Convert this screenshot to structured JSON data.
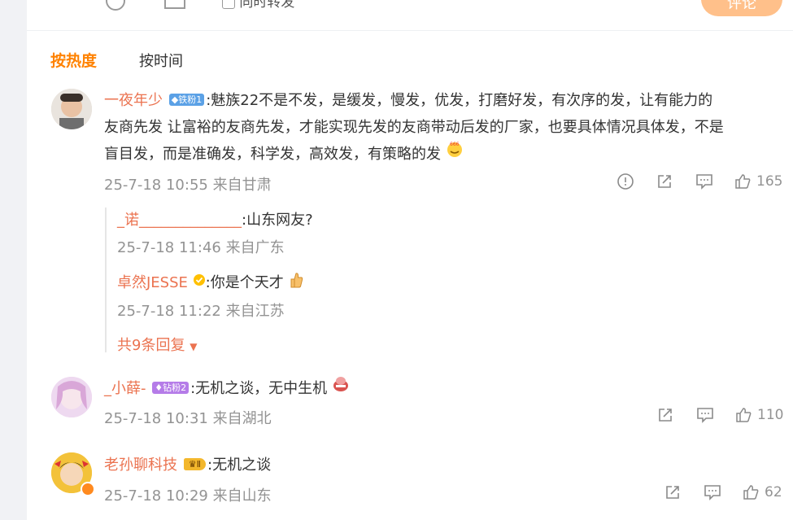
{
  "topbar": {
    "partial_label": "同时转发",
    "submit_label": "评论"
  },
  "sort": {
    "hot_label": "按热度",
    "time_label": "按时间"
  },
  "comments": [
    {
      "author": "一夜年少",
      "badge": "铁粉1",
      "text_line1": ":魅族22不是不发，是缓发，慢发，优发，打磨好发，有次序的发，让有能力的",
      "text_line2": "友商先发 让富裕的友商先发，才能实现先发的友商带动后发的厂家，也要具体情况具体发，不是",
      "text_line3": "盲目发，而是准确发，科学发，高效发，有策略的发",
      "time": "25-7-18 10:55 来自甘肃",
      "likes": "165",
      "replies": [
        {
          "author": "_诺______________",
          "text": ":山东网友?",
          "time": "25-7-18 11:46 来自广东"
        },
        {
          "author": "卓然JESSE",
          "text": ":你是个天才",
          "time": "25-7-18 11:22 来自江苏"
        }
      ],
      "more_replies": "共9条回复"
    },
    {
      "author": "_小薛-",
      "badge": "钻粉2",
      "text": ":无机之谈，无中生机",
      "time": "25-7-18 10:31 来自湖北",
      "likes": "110"
    },
    {
      "author": "老孙聊科技",
      "badge": "Ⅱ",
      "text": ":无机之谈",
      "time": "25-7-18 10:29 来自山东",
      "likes": "62"
    }
  ],
  "colors": {
    "accent": "#ff8200",
    "username": "#eb7350",
    "meta": "#939393"
  }
}
